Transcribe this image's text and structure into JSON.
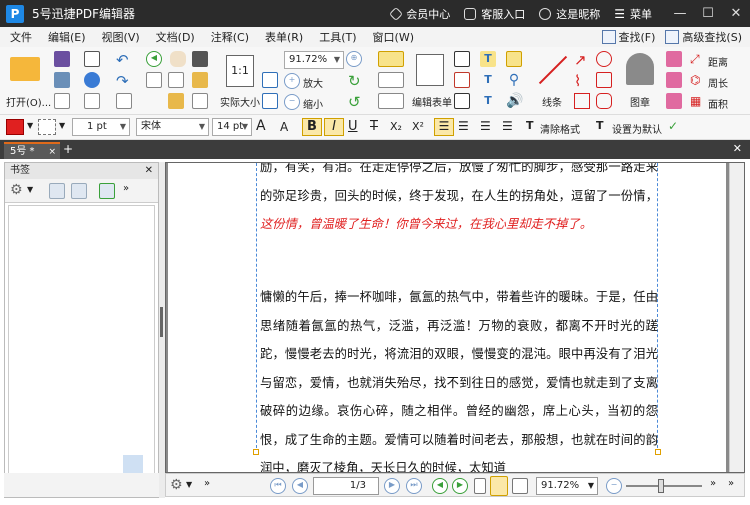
{
  "window": {
    "app_logo": "P",
    "title": "5号迅捷PDF编辑器",
    "member_center": "会员中心",
    "support": "客服入口",
    "nickname": "这是昵称",
    "menu_label": "菜单",
    "minimize": "—",
    "maximize": "☐",
    "close": "✕"
  },
  "menubar": {
    "items": [
      "文件",
      "编辑(E)",
      "视图(V)",
      "文档(D)",
      "注释(C)",
      "表单(R)",
      "工具(T)",
      "窗口(W)"
    ],
    "find": "查找(F)",
    "advanced_find": "高级查找(S)"
  },
  "ribbon": {
    "open": "打开(O)...",
    "actual_size": "实际大小",
    "actual_size_icon": "1:1",
    "zoom_value": "91.72%",
    "zoom_in": "放大",
    "zoom_out": "缩小",
    "edit_form": "编辑表单",
    "line": "线条",
    "stamp": "图章",
    "distance": "距离",
    "perimeter": "周长",
    "area": "面积"
  },
  "format": {
    "line_width": "1 pt",
    "font": "宋体",
    "font_size": "14 pt",
    "text_color": "#e02020",
    "bold": "B",
    "italic": "I",
    "underline": "U",
    "strike": "T",
    "subscript": "X₂",
    "superscript": "X²",
    "clear_format": "清除格式",
    "set_default": "设置为默认"
  },
  "tabs": {
    "active_tab": "5号 *",
    "tab_close": "×",
    "add_tab": "+",
    "close_all": "✕"
  },
  "left_panel": {
    "title": "书签",
    "close": "✕"
  },
  "document": {
    "paragraphs": [
      {
        "text": "励，有笑，有泪。在走走停停之后，放慢了匆忙的脚步，感受那一路走来的弥足珍贵，回头的时候，终于发现，在人生的拐角处，逗留了一份情，",
        "red": "这份情，曾温暖了生命！你曾今来过，在我心里却走不掉了。"
      },
      {
        "text": "慵懒的午后，捧一杯咖啡，氤氲的热气中，带着些许的暖昧。于是，任由思绪随着氤氲的热气，泛滥，再泛滥！万物的衰败，都离不开时光的蹉跎，慢慢老去的时光，将流泪的双眼，慢慢变的混沌。眼中再没有了泪光与留恋，爱情，也就消失殆尽，找不到往日的感觉，爱情也就走到了支离破碎的边缘。哀伤心碎，随之相伴。曾经的幽怨，席上心头，当初的怨恨，成了生命的主题。爱情可以随着时间老去，那般想，也就在时间的韵润中，磨灭了棱角，天长日久的时候，太知道"
      }
    ]
  },
  "statusbar": {
    "page_input": "1/3",
    "zoom_value": "91.72%"
  }
}
